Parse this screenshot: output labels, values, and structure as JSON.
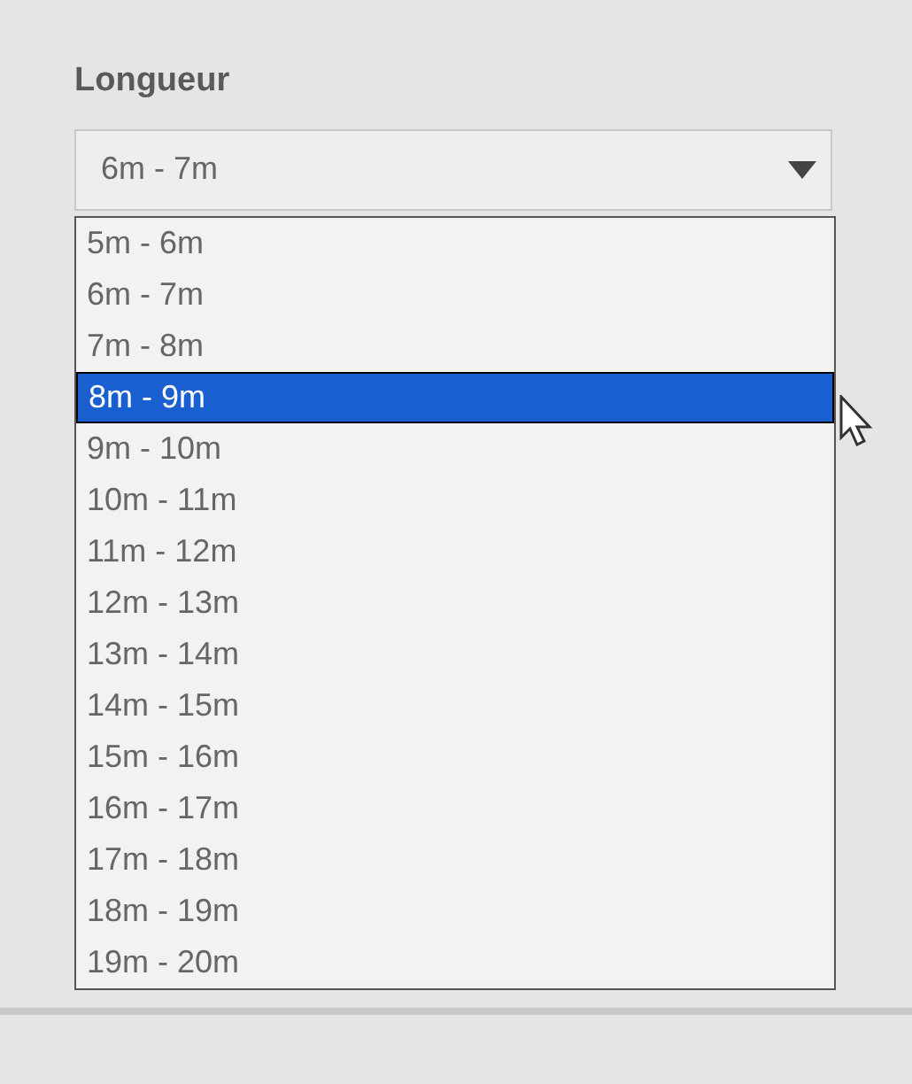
{
  "field_label": "Longueur",
  "select": {
    "value": "6m - 7m",
    "expanded": true
  },
  "options": [
    {
      "label": "5m - 6m",
      "selected": false
    },
    {
      "label": "6m - 7m",
      "selected": false
    },
    {
      "label": "7m - 8m",
      "selected": false
    },
    {
      "label": "8m - 9m",
      "selected": true
    },
    {
      "label": "9m - 10m",
      "selected": false
    },
    {
      "label": "10m - 11m",
      "selected": false
    },
    {
      "label": "11m - 12m",
      "selected": false
    },
    {
      "label": "12m - 13m",
      "selected": false
    },
    {
      "label": "13m - 14m",
      "selected": false
    },
    {
      "label": "14m - 15m",
      "selected": false
    },
    {
      "label": "15m - 16m",
      "selected": false
    },
    {
      "label": "16m - 17m",
      "selected": false
    },
    {
      "label": "17m - 18m",
      "selected": false
    },
    {
      "label": "18m - 19m",
      "selected": false
    },
    {
      "label": "19m - 20m",
      "selected": false
    }
  ]
}
